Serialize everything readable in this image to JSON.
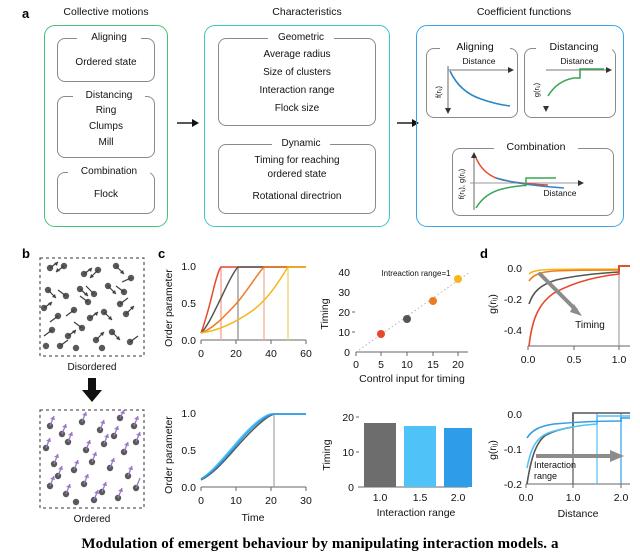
{
  "panels": {
    "a": "a",
    "b": "b",
    "c": "c",
    "d": "d"
  },
  "column_titles": {
    "collective": "Collective motions",
    "characteristics": "Characteristics",
    "coefficient": "Coefficient functions"
  },
  "colors": {
    "green": "#49c172",
    "teal": "#3fc4c4",
    "blue": "#35a7e8",
    "curve_blue": "#2f86c5",
    "curve_green": "#3aa657",
    "curve_red": "#e8472a",
    "curve_orange": "#f07a22",
    "curve_yellow": "#f5b71b",
    "curve_gray": "#555555",
    "bar_gray": "#6d6d6d",
    "bar_lightblue": "#4fc3f7",
    "bar_blue": "#2e9ce8",
    "purple": "#9b78c8",
    "agent_gray": "#595959"
  },
  "group_collective": [
    {
      "label": "Aligning",
      "items": [
        "Ordered state"
      ]
    },
    {
      "label": "Distancing",
      "items": [
        "Ring",
        "Clumps",
        "Mill"
      ]
    },
    {
      "label": "Combination",
      "items": [
        "Flock"
      ]
    }
  ],
  "group_characteristics": [
    {
      "label": "Geometric",
      "items": [
        "Average radius",
        "Size of clusters",
        "Interaction range",
        "Flock size"
      ]
    },
    {
      "label": "Dynamic",
      "items": [
        "Timing for reaching",
        "ordered state",
        "Rotational directrion"
      ]
    }
  ],
  "group_coefficient": [
    {
      "label": "Aligning",
      "xlabel": "Distance",
      "ylabel": "f(rᵢⱼ)"
    },
    {
      "label": "Distancing",
      "xlabel": "Distance",
      "ylabel": "g(rᵢⱼ)"
    },
    {
      "label": "Combination",
      "xlabel": "Distance",
      "ylabel": "f(rᵢⱼ), g(rᵢⱼ)"
    }
  ],
  "panel_b": {
    "top_caption": "Disordered",
    "bottom_caption": "Ordered"
  },
  "chart_data": [
    {
      "id": "c-top",
      "type": "line",
      "title": "",
      "xlabel": "",
      "ylabel": "Order parameter",
      "xlim": [
        0,
        60
      ],
      "ylim": [
        0.0,
        1.05
      ],
      "xticks": [
        0,
        20,
        40,
        60
      ],
      "xticklabels": [
        "0",
        "20",
        "40",
        "60"
      ],
      "yticks": [
        0.0,
        0.5,
        1.0
      ],
      "yticklabels": [
        "0.0",
        "0.5",
        "1.0"
      ],
      "grid": false,
      "series": [
        {
          "name": "input 5",
          "color": "#e8472a",
          "saturation_time": 11.5,
          "x": [
            0,
            1,
            2,
            3,
            4,
            5,
            6,
            7,
            8,
            9,
            10,
            11,
            11.5,
            20,
            40,
            60
          ],
          "y": [
            0.09,
            0.18,
            0.3,
            0.42,
            0.54,
            0.65,
            0.76,
            0.85,
            0.92,
            0.97,
            0.995,
            1.0,
            1.0,
            1.0,
            1.0,
            1.0
          ]
        },
        {
          "name": "input 10",
          "color": "#555555",
          "saturation_time": 21,
          "x": [
            0,
            2,
            4,
            6,
            8,
            10,
            12,
            14,
            16,
            18,
            20,
            21,
            30,
            45,
            60
          ],
          "y": [
            0.09,
            0.16,
            0.25,
            0.35,
            0.46,
            0.57,
            0.69,
            0.8,
            0.89,
            0.96,
            0.995,
            1.0,
            1.0,
            1.0,
            1.0
          ]
        },
        {
          "name": "input 15",
          "color": "#f07a22",
          "saturation_time": 36,
          "x": [
            0,
            4,
            8,
            12,
            16,
            20,
            24,
            28,
            32,
            35,
            36,
            45,
            60
          ],
          "y": [
            0.09,
            0.15,
            0.23,
            0.33,
            0.45,
            0.58,
            0.72,
            0.85,
            0.95,
            0.995,
            1.0,
            1.0,
            1.0
          ]
        },
        {
          "name": "input 20",
          "color": "#f5b71b",
          "saturation_time": 50,
          "x": [
            0,
            5,
            10,
            15,
            20,
            25,
            30,
            35,
            40,
            45,
            49,
            50,
            60
          ],
          "y": [
            0.09,
            0.13,
            0.19,
            0.26,
            0.35,
            0.46,
            0.58,
            0.71,
            0.84,
            0.94,
            0.995,
            1.0,
            1.0
          ]
        }
      ],
      "vlines": [
        {
          "x": 11.5,
          "color": "#f5a89a"
        },
        {
          "x": 21,
          "color": "#9a9a9a"
        },
        {
          "x": 36,
          "color": "#f5b39a"
        },
        {
          "x": 50,
          "color": "#f5d27a"
        }
      ]
    },
    {
      "id": "c-right-top",
      "type": "scatter",
      "title": "",
      "annotation": "Intreaction range=1",
      "xlabel": "Control input for timing",
      "ylabel": "Timing",
      "xlim": [
        0,
        22
      ],
      "ylim": [
        0,
        44
      ],
      "xticks": [
        0,
        5,
        10,
        15,
        20
      ],
      "xticklabels": [
        "0",
        "5",
        "10",
        "15",
        "20"
      ],
      "yticks": [
        0,
        10,
        20,
        30,
        40
      ],
      "yticklabels": [
        "0",
        "10",
        "20",
        "30",
        "40"
      ],
      "grid": false,
      "trendline": {
        "style": "dotted",
        "color": "#aaaaaa",
        "x": [
          0.5,
          22
        ],
        "y": [
          1,
          43
        ]
      },
      "points": [
        {
          "x": 5,
          "y": 10,
          "color": "#e8472a"
        },
        {
          "x": 10,
          "y": 18,
          "color": "#555555"
        },
        {
          "x": 15,
          "y": 28,
          "color": "#f07a22"
        },
        {
          "x": 20,
          "y": 40,
          "color": "#f5b71b"
        }
      ]
    },
    {
      "id": "d-top",
      "type": "line",
      "title": "",
      "xlabel": "",
      "ylabel": "g(rᵢⱼ)",
      "annotation": "Timing",
      "xlim": [
        0.0,
        1.12
      ],
      "ylim": [
        -0.5,
        0.03
      ],
      "xticks": [
        0.0,
        0.5,
        1.0
      ],
      "xticklabels": [
        "0.0",
        "0.5",
        "1.0"
      ],
      "yticks": [
        0.0,
        -0.2,
        -0.4
      ],
      "yticklabels": [
        "0.0",
        "-0.2",
        "-0.4"
      ],
      "grid": false,
      "series": [
        {
          "name": "input 20",
          "color": "#f5b71b",
          "depth": -0.035,
          "step_x": 1.0,
          "step_y": 0.005
        },
        {
          "name": "input 15",
          "color": "#f07a22",
          "depth": -0.07,
          "step_x": 1.0,
          "step_y": 0.005
        },
        {
          "name": "input 10",
          "color": "#555555",
          "depth": -0.2,
          "step_x": 1.0,
          "step_y": 0.005
        },
        {
          "name": "input 5",
          "color": "#e8472a",
          "depth": -0.5,
          "step_x": 1.0,
          "step_y": 0.005
        }
      ],
      "vline": {
        "x": 1.0,
        "color": "#9a9a9a"
      }
    },
    {
      "id": "c-bottom",
      "type": "line",
      "title": "",
      "xlabel": "Time",
      "ylabel": "Order parameter",
      "xlim": [
        0,
        30
      ],
      "ylim": [
        0.0,
        1.05
      ],
      "xticks": [
        0,
        10,
        20,
        30
      ],
      "xticklabels": [
        "0",
        "10",
        "20",
        "30"
      ],
      "yticks": [
        0.0,
        0.5,
        1.0
      ],
      "yticklabels": [
        "0.0",
        "0.5",
        "1.0"
      ],
      "grid": false,
      "series": [
        {
          "name": "range 1.0",
          "color": "#555555",
          "saturation_time": 21,
          "x": [
            0,
            2,
            4,
            6,
            8,
            10,
            12,
            14,
            16,
            18,
            20,
            21,
            25,
            30
          ],
          "y": [
            0.09,
            0.155,
            0.235,
            0.325,
            0.425,
            0.535,
            0.655,
            0.775,
            0.88,
            0.955,
            0.995,
            1.0,
            1.0,
            1.0
          ]
        },
        {
          "name": "range 1.5",
          "color": "#4fc3f7",
          "saturation_time": 20.5,
          "x": [
            0,
            2,
            4,
            6,
            8,
            10,
            12,
            14,
            16,
            18,
            20,
            20.5,
            25,
            30
          ],
          "y": [
            0.1,
            0.175,
            0.26,
            0.355,
            0.46,
            0.575,
            0.695,
            0.81,
            0.905,
            0.97,
            0.998,
            1.0,
            1.0,
            1.0
          ]
        },
        {
          "name": "range 2.0",
          "color": "#2e9ce8",
          "saturation_time": 20.8,
          "x": [
            0,
            2,
            4,
            6,
            8,
            10,
            12,
            14,
            16,
            18,
            20,
            20.8,
            25,
            30
          ],
          "y": [
            0.1,
            0.17,
            0.255,
            0.35,
            0.455,
            0.565,
            0.685,
            0.8,
            0.9,
            0.965,
            0.997,
            1.0,
            1.0,
            1.0
          ]
        }
      ],
      "vline": {
        "x": 21,
        "color": "#9a9a9a"
      }
    },
    {
      "id": "c-right-bottom",
      "type": "bar",
      "title": "",
      "xlabel": "Interaction range",
      "ylabel": "Timing",
      "categories": [
        "1.0",
        "1.5",
        "2.0"
      ],
      "values": [
        18.5,
        17.5,
        17.1
      ],
      "colors": [
        "#6d6d6d",
        "#4fc3f7",
        "#2e9ce8"
      ],
      "ylim": [
        0,
        21
      ],
      "yticks": [
        0,
        10,
        20
      ],
      "yticklabels": [
        "0",
        "10",
        "20"
      ],
      "grid": false
    },
    {
      "id": "d-bottom",
      "type": "line",
      "title": "",
      "xlabel": "Distance",
      "ylabel": "g(rᵢⱼ)",
      "annotation": "Interaction\nrange",
      "annotation_line1": "Interaction",
      "annotation_line2": "range",
      "xlim": [
        0.0,
        2.2
      ],
      "ylim": [
        -0.2,
        0.012
      ],
      "xticks": [
        0.0,
        1.0,
        2.0
      ],
      "xticklabels": [
        "0.0",
        "1.0",
        "2.0"
      ],
      "yticks": [
        0.0,
        -0.1,
        -0.2
      ],
      "yticklabels": [
        "0.0",
        "-0.1",
        "-0.2"
      ],
      "grid": false,
      "series": [
        {
          "name": "range 1.0",
          "color": "#555555",
          "depth": -0.2,
          "step_x": 1.0
        },
        {
          "name": "range 1.5",
          "color": "#4fc3f7",
          "depth": -0.13,
          "step_x": 1.5
        },
        {
          "name": "range 2.0",
          "color": "#2e9ce8",
          "depth": -0.06,
          "step_x": 2.0
        }
      ]
    }
  ],
  "caption": "Modulation  of  emergent  behaviour  by  manipulating  interaction  models.  a"
}
